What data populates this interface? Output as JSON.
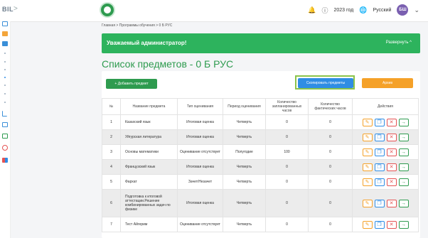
{
  "brand": {
    "text": "BIL",
    "chevron": ">"
  },
  "header": {
    "year": "2023 год",
    "language": "Русский",
    "avatar_initials": "БШ"
  },
  "breadcrumb": {
    "home": "Главная",
    "sep1": ">",
    "programs": "Программы обучения",
    "sep2": ">",
    "current": "0 Б РУС"
  },
  "banner": {
    "title": "Уважаемый администратор!",
    "expand": "Развернуть ^"
  },
  "page": {
    "title": "Список предметов - 0 Б РУС"
  },
  "buttons": {
    "add": "+  Добавить предмет",
    "copy": "Скопировать предметы",
    "archive": "Архив"
  },
  "table": {
    "headers": [
      "№",
      "Название предмета",
      "Тип оценивания",
      "Период оценивания",
      "Количество запланированных часов",
      "Количество фактических часов",
      "Действия"
    ],
    "rows": [
      {
        "num": "1",
        "name": "Казахский язык",
        "type": "Итоговая оценка",
        "period": "Четверть",
        "planned": "0",
        "actual": "0"
      },
      {
        "num": "2",
        "name": "Уйгурская литература",
        "type": "Итоговая оценка",
        "period": "Четверть",
        "planned": "0",
        "actual": "0"
      },
      {
        "num": "3",
        "name": "Основы математики",
        "type": "Оценивание отсутствует",
        "period": "Полугодие",
        "planned": "100",
        "actual": "0"
      },
      {
        "num": "4",
        "name": "Французский язык",
        "type": "Итоговая оценка",
        "period": "Четверть",
        "planned": "0",
        "actual": "0"
      },
      {
        "num": "5",
        "name": "Фархат",
        "type": "Зачет/Незачет",
        "period": "Четверть",
        "planned": "0",
        "actual": "0"
      },
      {
        "num": "6",
        "name": "Подготовка к итоговой аттестации.Решение комбинированных задач по физике",
        "type": "Итоговая оценка",
        "period": "Четверть",
        "planned": "0",
        "actual": "0"
      },
      {
        "num": "7",
        "name": "Тест Айгерим",
        "type": "Оценивание отсутствует",
        "period": "Четверть",
        "planned": "0",
        "actual": "0"
      }
    ]
  },
  "icons": {
    "edit": "pencil-icon",
    "copy": "copy-icon",
    "delete": "close-icon",
    "go": "arrow-right-icon"
  },
  "colors": {
    "primary": "#2e9b4f",
    "banner": "#2db35d",
    "copy": "#2f8de4",
    "archive": "#f5a128",
    "delete": "#e55353"
  }
}
